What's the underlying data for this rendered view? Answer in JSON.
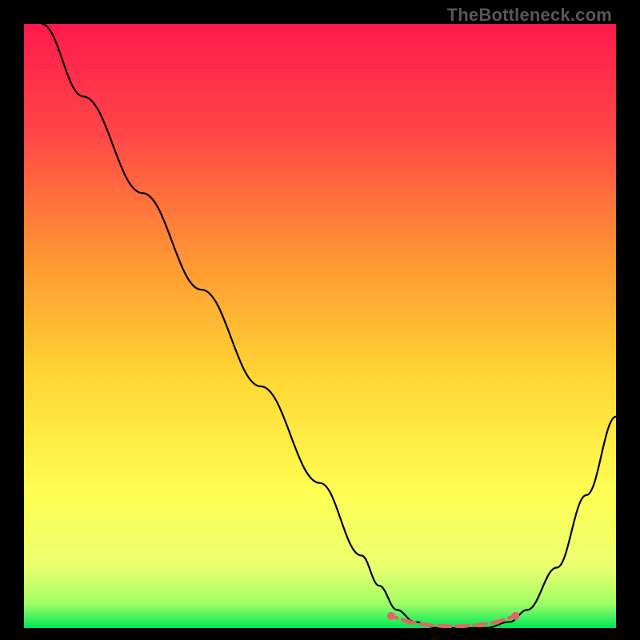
{
  "watermark": "TheBottleneck.com",
  "chart_data": {
    "type": "line",
    "title": "",
    "xlabel": "",
    "ylabel": "",
    "xlim": [
      0,
      100
    ],
    "ylim": [
      0,
      100
    ],
    "grid": false,
    "series": [
      {
        "name": "bottleneck-curve",
        "color": "#000000",
        "x": [
          3,
          10,
          20,
          30,
          40,
          50,
          57,
          60,
          63,
          66,
          70,
          74,
          78,
          82,
          85,
          90,
          95,
          100
        ],
        "y": [
          100,
          88,
          72,
          56,
          40,
          24,
          12,
          7,
          3,
          1,
          0,
          0,
          0,
          1,
          3,
          10,
          22,
          35
        ]
      }
    ],
    "highlight": {
      "name": "optimal-range",
      "color": "#e06666",
      "x": [
        62,
        65,
        68,
        71,
        74,
        77,
        80,
        83
      ],
      "y": [
        2,
        1,
        0.5,
        0.3,
        0.3,
        0.5,
        1,
        2
      ]
    },
    "background_gradient": {
      "stops": [
        {
          "offset": 0.0,
          "color": "#ff1a4d"
        },
        {
          "offset": 0.18,
          "color": "#ff4747"
        },
        {
          "offset": 0.4,
          "color": "#ff9a33"
        },
        {
          "offset": 0.58,
          "color": "#ffd633"
        },
        {
          "offset": 0.78,
          "color": "#ffff55"
        },
        {
          "offset": 0.9,
          "color": "#eaff70"
        },
        {
          "offset": 0.96,
          "color": "#9fff66"
        },
        {
          "offset": 1.0,
          "color": "#00e858"
        }
      ]
    }
  }
}
